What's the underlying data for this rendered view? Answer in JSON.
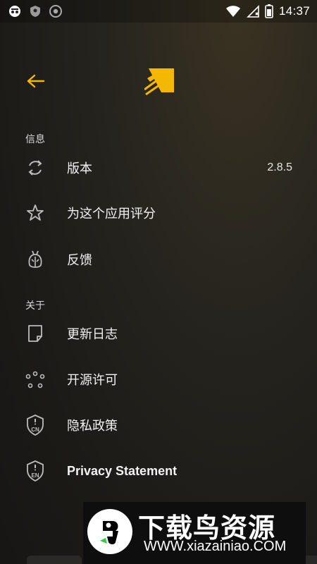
{
  "status_bar": {
    "time": "14:37",
    "icons": [
      "incognito-icon",
      "shield-notification-icon",
      "chrome-icon",
      "wifi-icon",
      "no-sim-icon",
      "battery-icon"
    ]
  },
  "header": {
    "back_icon": "arrow-left-icon",
    "logo_icon": "app-logo-icon"
  },
  "sections": {
    "info": {
      "title": "信息",
      "items": [
        {
          "label": "版本",
          "value": "2.8.5",
          "icon": "refresh-icon"
        },
        {
          "label": "为这个应用评分",
          "icon": "star-icon"
        },
        {
          "label": "反馈",
          "icon": "bug-icon"
        }
      ]
    },
    "about": {
      "title": "关于",
      "items": [
        {
          "label": "更新日志",
          "icon": "note-icon"
        },
        {
          "label": "开源许可",
          "icon": "open-source-icon"
        },
        {
          "label": "隐私政策",
          "icon": "privacy-cn-icon",
          "badge": "CN"
        },
        {
          "label": "Privacy Statement",
          "icon": "privacy-en-icon",
          "badge": "EN"
        }
      ]
    }
  },
  "watermark": {
    "title": "下载鸟资源",
    "url": "WWW.xiazainiao.COM"
  },
  "colors": {
    "accent": "#f5b800",
    "icon_gray": "#bdbdbd"
  }
}
